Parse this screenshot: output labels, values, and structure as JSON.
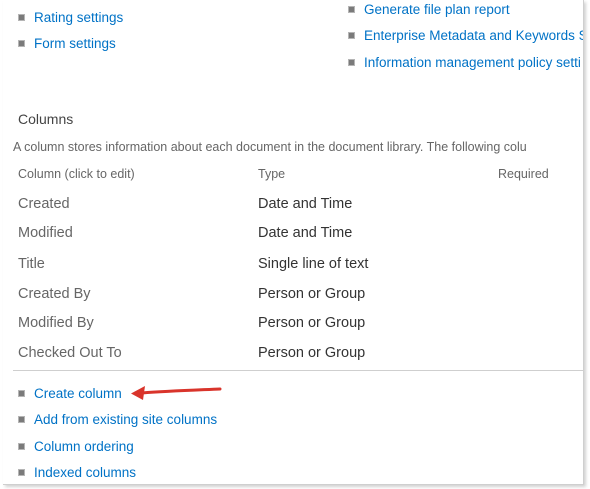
{
  "top_links_left": [
    {
      "label": "Rating settings"
    },
    {
      "label": "Form settings"
    }
  ],
  "top_links_right": [
    {
      "label": "Generate file plan report"
    },
    {
      "label": "Enterprise Metadata and Keywords Se"
    },
    {
      "label": "Information management policy setti"
    }
  ],
  "columns_section": {
    "title": "Columns",
    "description": "A column stores information about each document in the document library. The following colu",
    "headers": {
      "name": "Column (click to edit)",
      "type": "Type",
      "required": "Required"
    },
    "rows": [
      {
        "name": "Created",
        "type": "Date and Time"
      },
      {
        "name": "Modified",
        "type": "Date and Time"
      },
      {
        "name": "Title",
        "type": "Single line of text"
      },
      {
        "name": "Created By",
        "type": "Person or Group"
      },
      {
        "name": "Modified By",
        "type": "Person or Group"
      },
      {
        "name": "Checked Out To",
        "type": "Person or Group"
      }
    ]
  },
  "column_actions": [
    {
      "label": "Create column"
    },
    {
      "label": "Add from existing site columns"
    },
    {
      "label": "Column ordering"
    },
    {
      "label": "Indexed columns"
    }
  ],
  "colors": {
    "link": "#0072c6",
    "annotation_arrow": "#d9342b"
  },
  "icons": {
    "bullet": "square-bullet-icon",
    "arrow": "red-arrow-annotation-icon"
  }
}
